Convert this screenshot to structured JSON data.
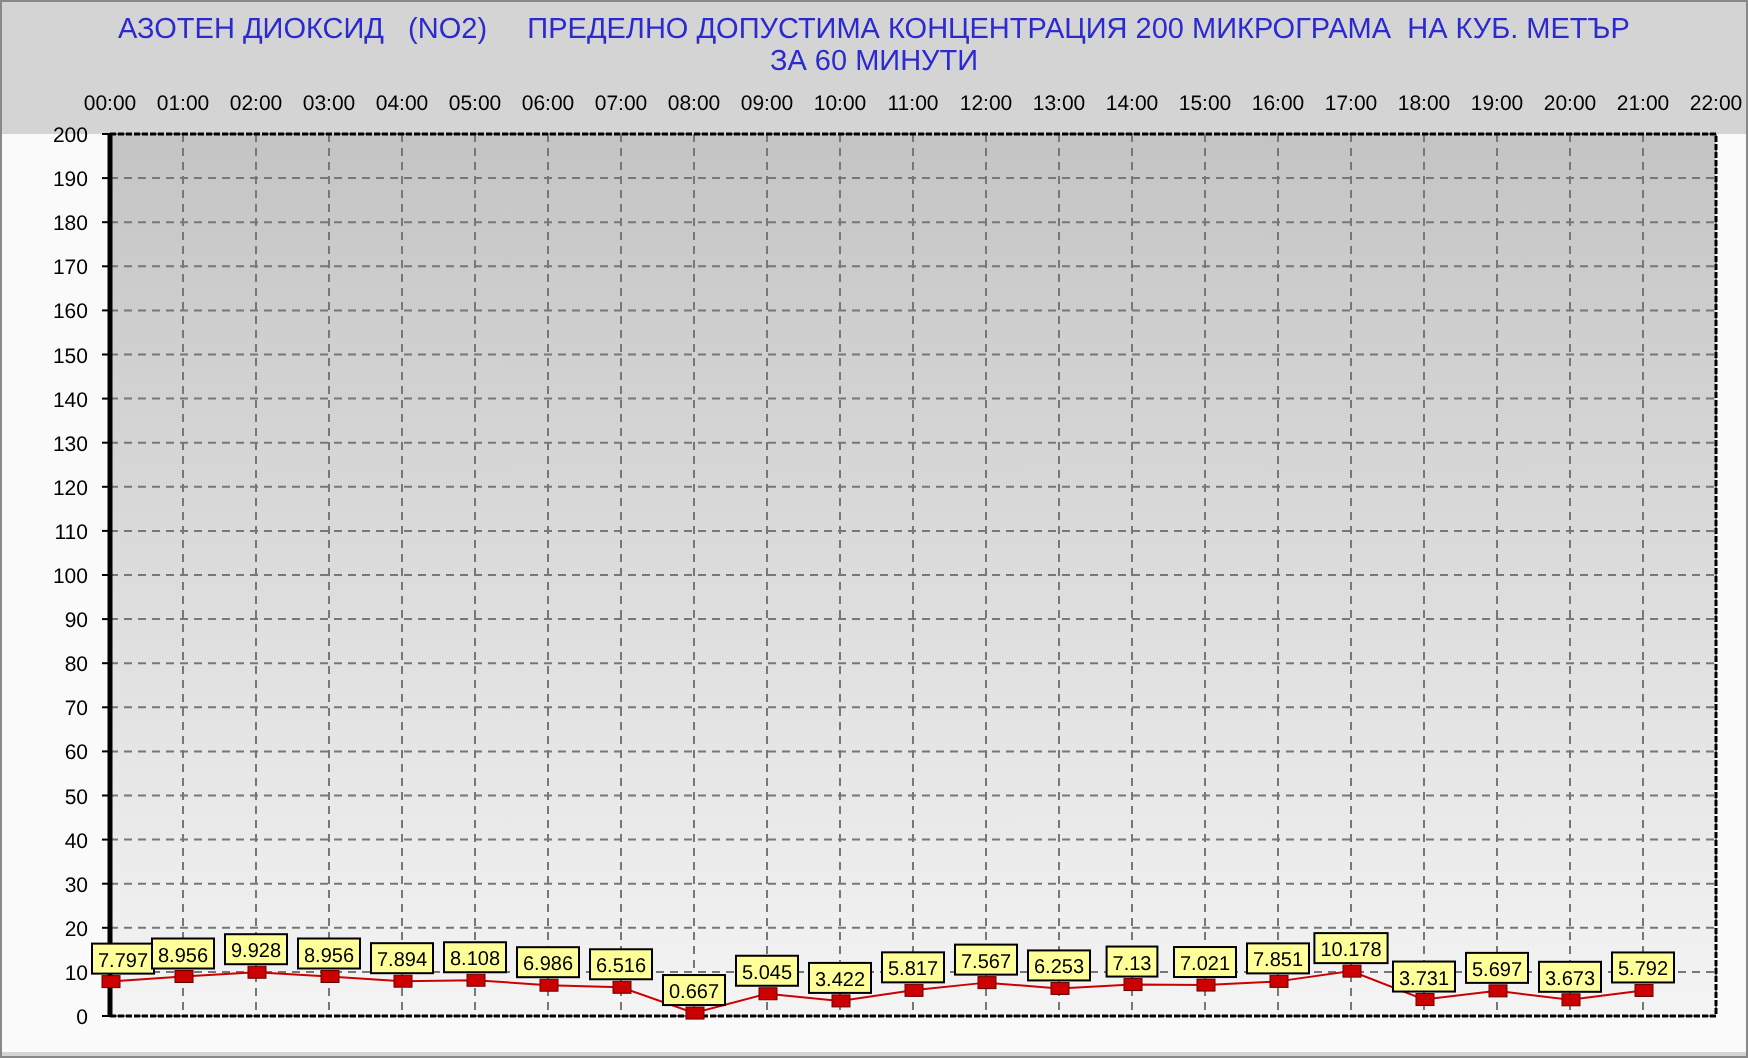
{
  "title_lines": [
    "АЗОТЕН ДИОКСИД   (NO2)     ПРЕДЕЛНО ДОПУСТИМА КОНЦЕНТРАЦИЯ 200 МИКРОГРАМА  НА КУБ. МЕТЪР",
    "ЗА 60 МИНУТИ"
  ],
  "chart": {
    "chart_data": {
      "type": "line",
      "grid": true,
      "data_labels": true,
      "categories": [
        "00:00",
        "01:00",
        "02:00",
        "03:00",
        "04:00",
        "05:00",
        "06:00",
        "07:00",
        "08:00",
        "09:00",
        "10:00",
        "11:00",
        "12:00",
        "13:00",
        "14:00",
        "15:00",
        "16:00",
        "17:00",
        "18:00",
        "19:00",
        "20:00",
        "21:00",
        "22:00"
      ],
      "series": [
        {
          "color": "#cc0000",
          "marker": "square",
          "values": [
            7.797,
            8.956,
            9.928,
            8.956,
            7.894,
            8.108,
            6.986,
            6.516,
            0.667,
            5.045,
            3.422,
            5.817,
            7.567,
            6.253,
            7.13,
            7.021,
            7.851,
            10.178,
            3.731,
            5.697,
            3.673,
            5.792,
            null
          ]
        }
      ],
      "ylim": [
        0,
        200
      ],
      "yticks": [
        0,
        10,
        20,
        30,
        40,
        50,
        60,
        70,
        80,
        90,
        100,
        110,
        120,
        130,
        140,
        150,
        160,
        170,
        180,
        190,
        200
      ]
    }
  }
}
